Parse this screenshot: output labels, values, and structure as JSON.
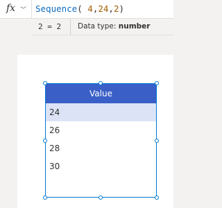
{
  "formula_bar": {
    "fx_label": "fx",
    "chevron": "﹀",
    "function_name": "Sequence",
    "open_paren": "( ",
    "arg1": "4",
    "comma1": ",",
    "arg2": "24",
    "comma2": ",",
    "arg3": "2",
    "close_paren": ")"
  },
  "result": {
    "expression": "2 = 2",
    "type_label": "Data type: ",
    "type_value": "number"
  },
  "gallery": {
    "header": "Value",
    "rows": [
      "24",
      "26",
      "28",
      "30"
    ],
    "selected_row_index": 0
  },
  "colors": {
    "header_bg": "#3a5fc7",
    "selected_row_bg": "#dce3f7",
    "selection_border": "#0078d4",
    "function_color": "#0f6cbd",
    "number_color": "#a15c00"
  }
}
